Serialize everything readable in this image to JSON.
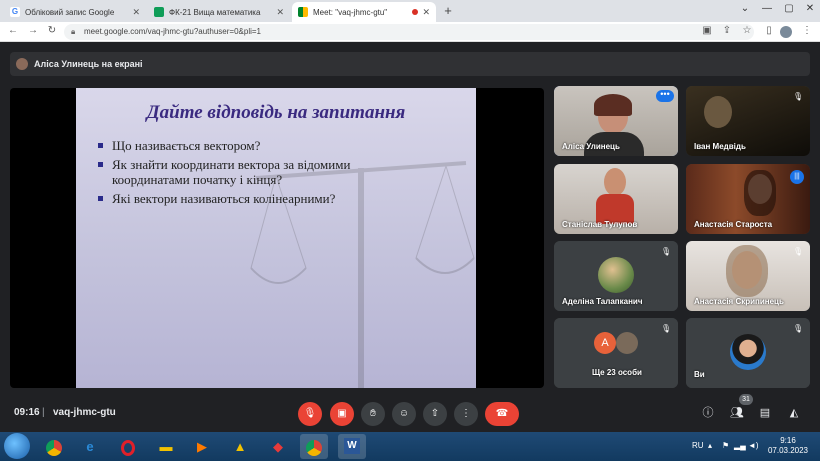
{
  "browser": {
    "tabs": [
      {
        "label": "Обліковий запис Google",
        "favicon": "google-icon"
      },
      {
        "label": "ФК-21 Вища математика",
        "favicon": "classroom-icon"
      },
      {
        "label": "Meet: \"vaq-jhmc-gtu\"",
        "favicon": "meet-icon"
      }
    ],
    "url": "meet.google.com/vaq-jhmc-gtu?authuser=0&pli=1"
  },
  "presenter": {
    "label": "Аліса Улинець на екрані"
  },
  "slide": {
    "title": "Дайте відповідь на запитання",
    "bullets": [
      "Що називається вектором?",
      "Як знайти координати вектора за відомими координатами початку і кінця?",
      "Які вектори називаються колінеарними?"
    ]
  },
  "participants": [
    {
      "name": "Аліса Улинець",
      "muted": false,
      "active": true
    },
    {
      "name": "Іван Медвідь",
      "muted": true
    },
    {
      "name": "Станіслав Тулупов",
      "muted": false
    },
    {
      "name": "Анастасія Староста",
      "muted": false,
      "speaking": true
    },
    {
      "name": "Аделіна Талапканич",
      "muted": true
    },
    {
      "name": "Анастасія Скрипинець",
      "muted": true
    },
    {
      "name": "Ще 23 особи",
      "avatar_letter": "A",
      "muted": true
    },
    {
      "name": "Ви",
      "muted": true
    }
  ],
  "meeting": {
    "time": "09:16",
    "separator": "|",
    "code": "vaq-jhmc-gtu",
    "participant_count": "31"
  },
  "taskbar": {
    "lang": "RU",
    "time": "9:16",
    "date": "07.03.2023"
  },
  "colors": {
    "meet_bg": "#202124",
    "danger": "#ea4335",
    "accent": "#1a73e8",
    "slide_title": "#3a2a80"
  }
}
